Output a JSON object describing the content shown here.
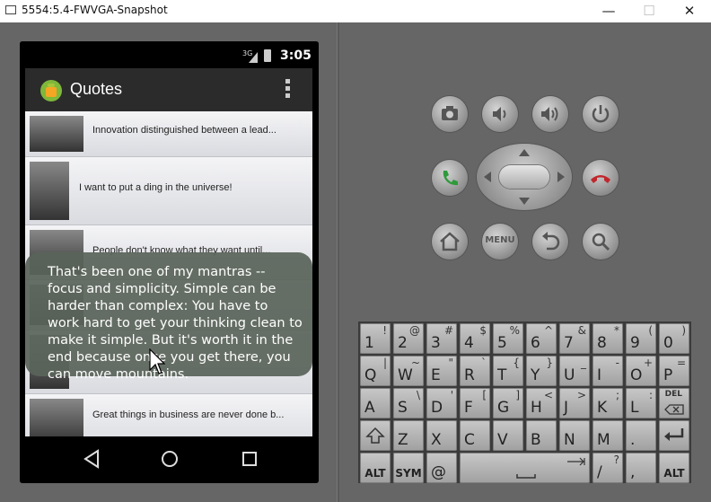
{
  "window": {
    "title": "5554:5.4-FWVGA-Snapshot",
    "minimize": "—",
    "maximize": "☐",
    "close": "✕"
  },
  "statusbar": {
    "network": "3G",
    "time": "3:05"
  },
  "actionbar": {
    "title": "Quotes"
  },
  "quotes": [
    "Innovation distinguished between a lead...",
    "I want to put a ding in the universe!",
    "People don't know what they want until...",
    "...",
    "...",
    "Great things in business are never done b..."
  ],
  "toast": {
    "text": "That's been one of my mantras -- focus and simplicity. Simple can be harder than complex: You have to work hard to get your thinking clean to make it simple. But it's worth it in the end because once you get there, you can move mountains."
  },
  "keyboard": {
    "row1": [
      [
        "1",
        "!"
      ],
      [
        "2",
        "@"
      ],
      [
        "3",
        "#"
      ],
      [
        "4",
        "$"
      ],
      [
        "5",
        "%"
      ],
      [
        "6",
        "^"
      ],
      [
        "7",
        "&"
      ],
      [
        "8",
        "*"
      ],
      [
        "9",
        "("
      ],
      [
        "0",
        ")"
      ]
    ],
    "row2": [
      [
        "Q",
        "|"
      ],
      [
        "W",
        "~"
      ],
      [
        "E",
        "\""
      ],
      [
        "R",
        "`"
      ],
      [
        "T",
        "{"
      ],
      [
        "Y",
        "}"
      ],
      [
        "U",
        "_"
      ],
      [
        "I",
        "-"
      ],
      [
        "O",
        "+"
      ],
      [
        "P",
        "="
      ]
    ],
    "row3": [
      [
        "A",
        ""
      ],
      [
        "S",
        "\\"
      ],
      [
        "D",
        "'"
      ],
      [
        "F",
        "["
      ],
      [
        "G",
        "]"
      ],
      [
        "H",
        "<"
      ],
      [
        "J",
        ">"
      ],
      [
        "K",
        ";"
      ],
      [
        "L",
        ":"
      ]
    ],
    "row4": [
      "Z",
      "X",
      "C",
      "V",
      "B",
      "N",
      "M",
      "."
    ],
    "del": "DEL",
    "alt": "ALT",
    "sym": "SYM",
    "at": "@",
    "slash": "/",
    "question": "?",
    "comma": ","
  },
  "menu_button": "MENU"
}
